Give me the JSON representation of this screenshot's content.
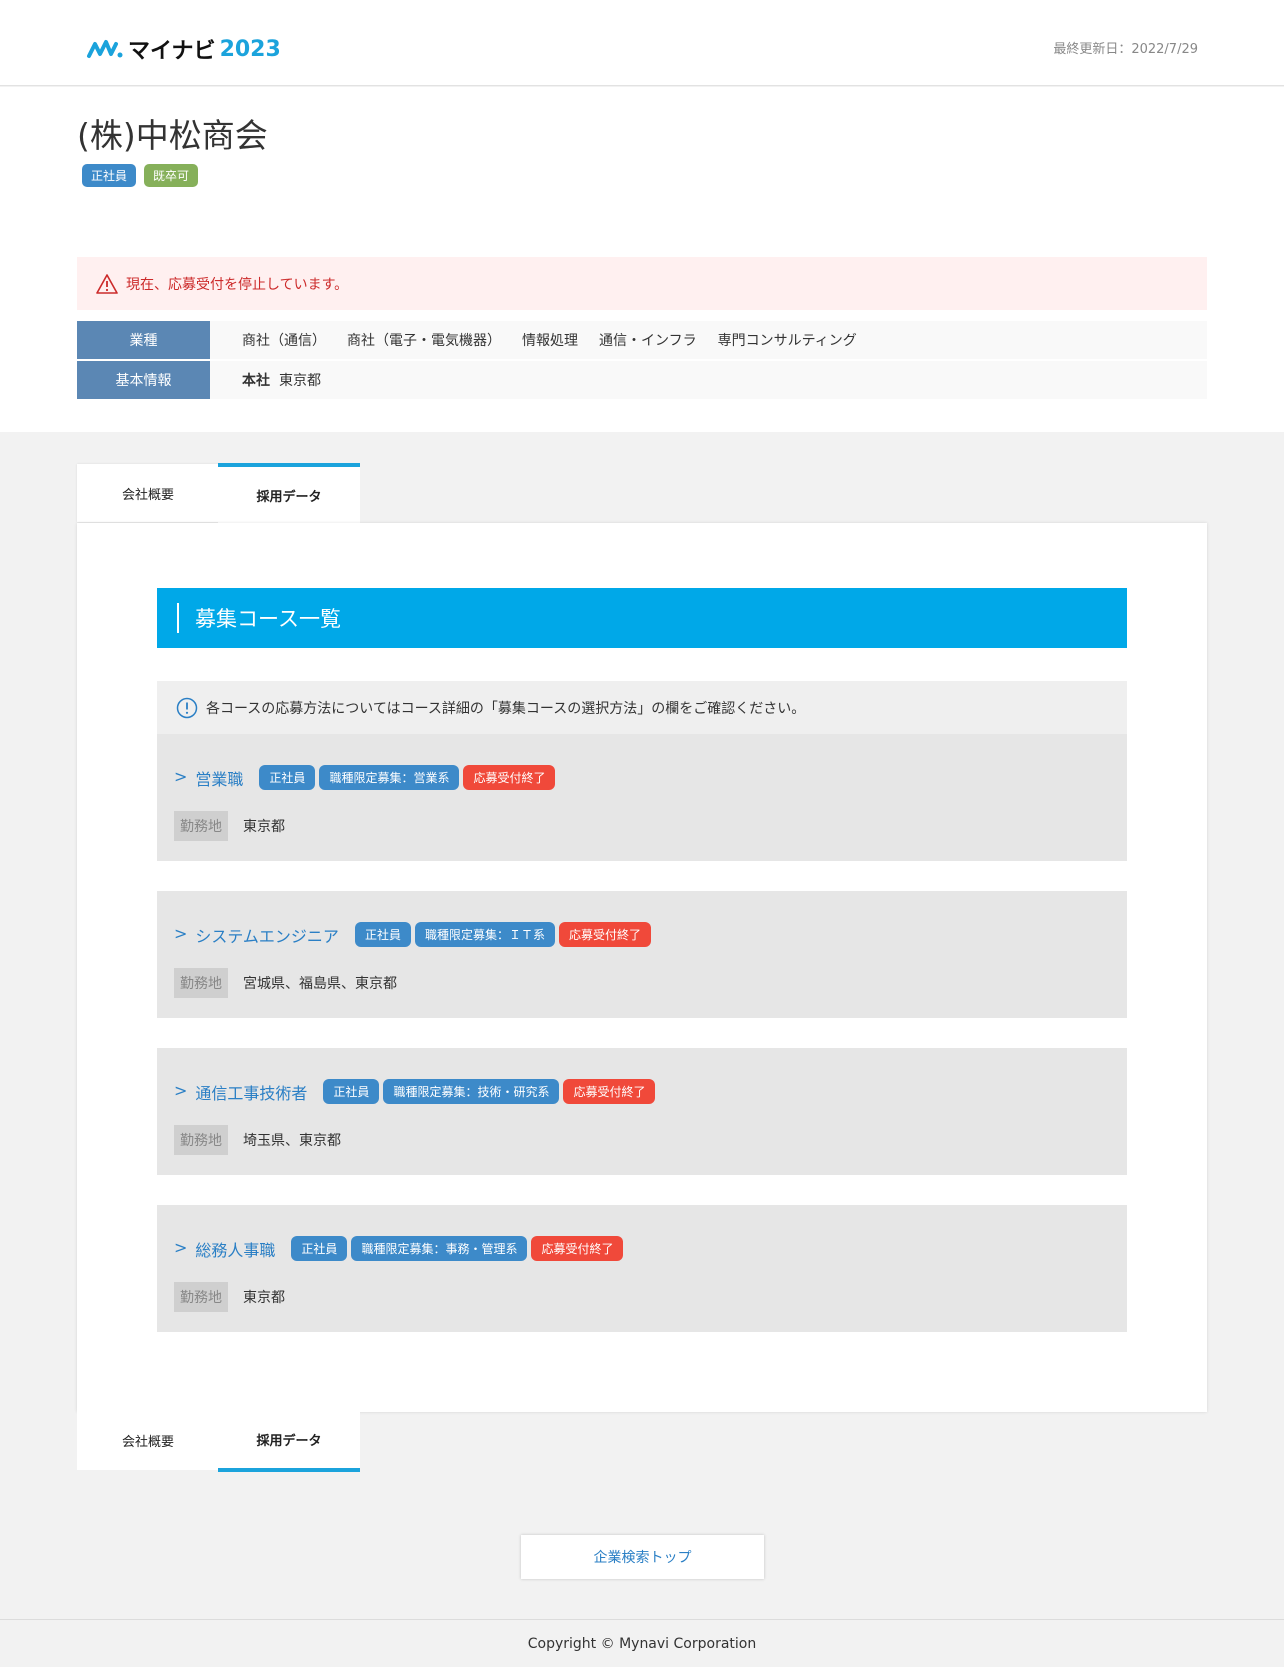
{
  "header": {
    "logo_text": "マイナビ",
    "logo_year": "2023",
    "updated": "最終更新日：2022/7/29"
  },
  "company": {
    "name": "(株)中松商会",
    "tags": [
      "正社員",
      "既卒可"
    ]
  },
  "alert": {
    "text": "現在、応募受付を停止しています。"
  },
  "info": {
    "industry_label": "業種",
    "industries": [
      "商社（通信）",
      "商社（電子・電気機器）",
      "情報処理",
      "通信・インフラ",
      "専門コンサルティング"
    ],
    "basic_label": "基本情報",
    "hq_label": "本社",
    "hq_value": "東京都"
  },
  "tabs": {
    "overview": "会社概要",
    "recruit": "採用データ"
  },
  "section": {
    "title": "募集コース一覧",
    "notice": "各コースの応募方法についてはコース詳細の「募集コースの選択方法」の欄をご確認ください。",
    "location_label": "勤務地"
  },
  "courses": [
    {
      "name": "営業職",
      "tag1": "正社員",
      "tag2": "職種限定募集：営業系",
      "tag3": "応募受付終了",
      "location": "東京都"
    },
    {
      "name": "システムエンジニア",
      "tag1": "正社員",
      "tag2": "職種限定募集：ＩＴ系",
      "tag3": "応募受付終了",
      "location": "宮城県、福島県、東京都"
    },
    {
      "name": "通信工事技術者",
      "tag1": "正社員",
      "tag2": "職種限定募集：技術・研究系",
      "tag3": "応募受付終了",
      "location": "埼玉県、東京都"
    },
    {
      "name": "総務人事職",
      "tag1": "正社員",
      "tag2": "職種限定募集：事務・管理系",
      "tag3": "応募受付終了",
      "location": "東京都"
    }
  ],
  "buttons": {
    "search_top": "企業検索トップ"
  },
  "footer": {
    "copyright": "Copyright © Mynavi Corporation"
  },
  "colors": {
    "accent": "#00a8e8",
    "label_bg": "#5b87b4",
    "tag_blue": "#3d8ac9",
    "tag_green": "#86b05a",
    "tag_red": "#f0493a",
    "alert_text": "#cc2a2a"
  }
}
